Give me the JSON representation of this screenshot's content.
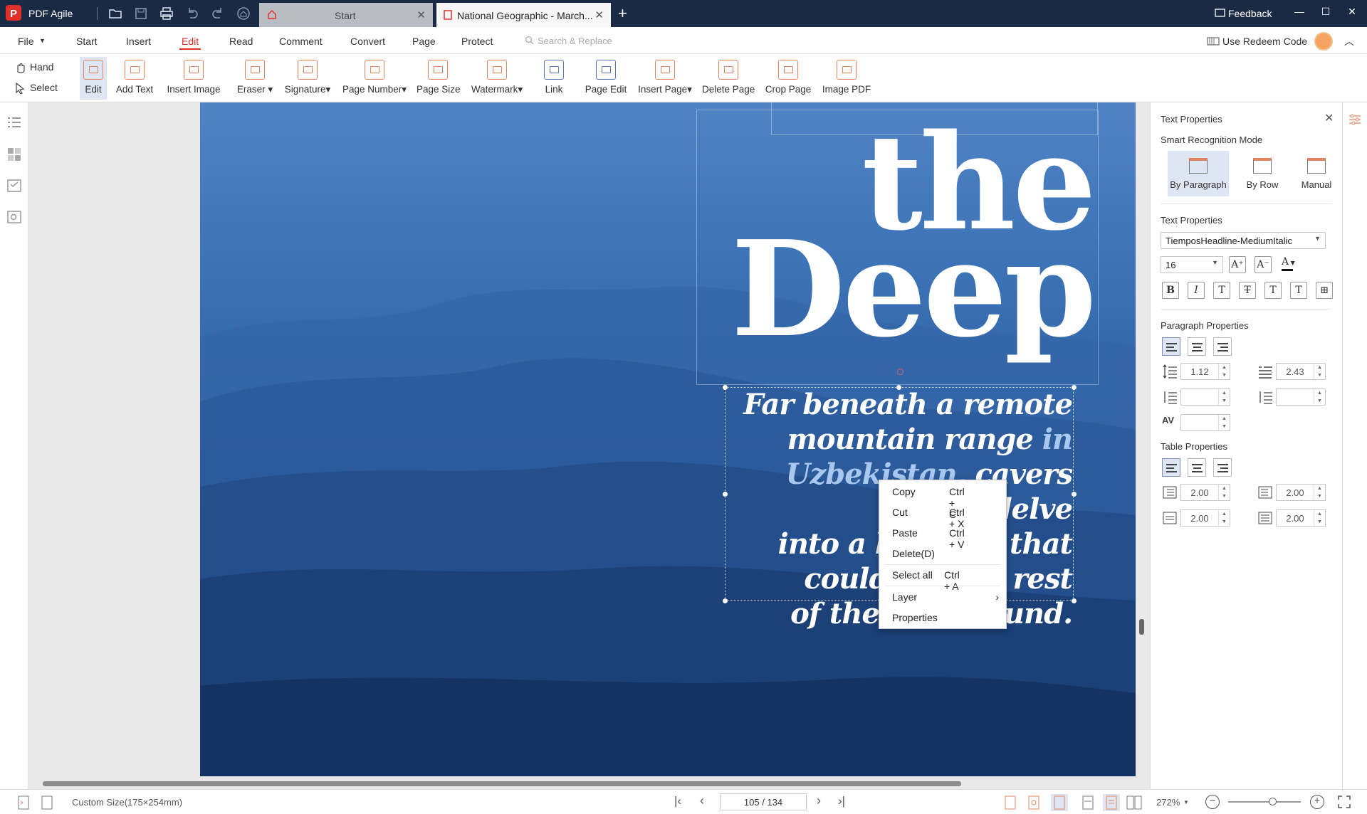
{
  "app": {
    "name": "PDF Agile",
    "quick_icons": [
      "open-folder-icon",
      "save-icon",
      "print-icon",
      "undo-icon",
      "redo-icon",
      "home-icon"
    ]
  },
  "tabs": [
    {
      "label": "Start"
    },
    {
      "label": "National Geographic - March..."
    }
  ],
  "titlebar": {
    "feedback": "Feedback"
  },
  "menu": {
    "file": "File",
    "items": [
      "Start",
      "Insert",
      "Edit",
      "Read",
      "Comment",
      "Convert",
      "Page",
      "Protect"
    ],
    "active": "Edit",
    "search_placeholder": "Search & Replace",
    "redeem": "Use Redeem Code"
  },
  "toolbar": {
    "hand": "Hand",
    "select": "Select",
    "tools": [
      "Edit",
      "Add Text",
      "Insert Image",
      "Eraser",
      "Signature",
      "Page Number",
      "Page Size",
      "Watermark",
      "Link",
      "Page Edit",
      "Insert Page",
      "Delete Page",
      "Crop Page",
      "Image PDF"
    ]
  },
  "document": {
    "title_lines": [
      "the",
      "Deep"
    ],
    "subtitle_lines": [
      "Far beneath a remote",
      "mountain range",
      "in",
      "Uzbekistan,",
      "cavers delve",
      "into a l",
      "that",
      "could",
      "rest",
      "of the",
      "und."
    ]
  },
  "context_menu": [
    {
      "label": "Copy",
      "shortcut": "Ctrl + C"
    },
    {
      "label": "Cut",
      "shortcut": "Ctrl + X"
    },
    {
      "label": "Paste",
      "shortcut": "Ctrl + V"
    },
    {
      "label": "Delete(D)",
      "shortcut": ""
    },
    {
      "label": "Select all",
      "shortcut": "Ctrl + A"
    },
    {
      "label": "Layer",
      "shortcut": "›"
    },
    {
      "label": "Properties",
      "shortcut": ""
    }
  ],
  "panel": {
    "title": "Text Properties",
    "recognition_label": "Smart Recognition Mode",
    "modes": [
      "By Paragraph",
      "By Row",
      "Manual"
    ],
    "text_props_label": "Text Properties",
    "font": "TiemposHeadline-MediumItalic",
    "size": "16",
    "style_buttons": [
      "B",
      "I",
      "T",
      "T",
      "T",
      "T",
      "⊞"
    ],
    "paragraph_label": "Paragraph Properties",
    "line_spacing": "1.12",
    "para_spacing": "2.43",
    "table_label": "Table Properties",
    "cell_values": [
      "2.00",
      "2.00",
      "2.00",
      "2.00"
    ]
  },
  "status": {
    "page_size": "Custom Size(175×254mm)",
    "page_indicator": "105 / 134",
    "zoom": "272%"
  },
  "colors": {
    "titlebar": "#1b2a44",
    "accent": "#e1302a",
    "selection": "#dfe6f3"
  }
}
